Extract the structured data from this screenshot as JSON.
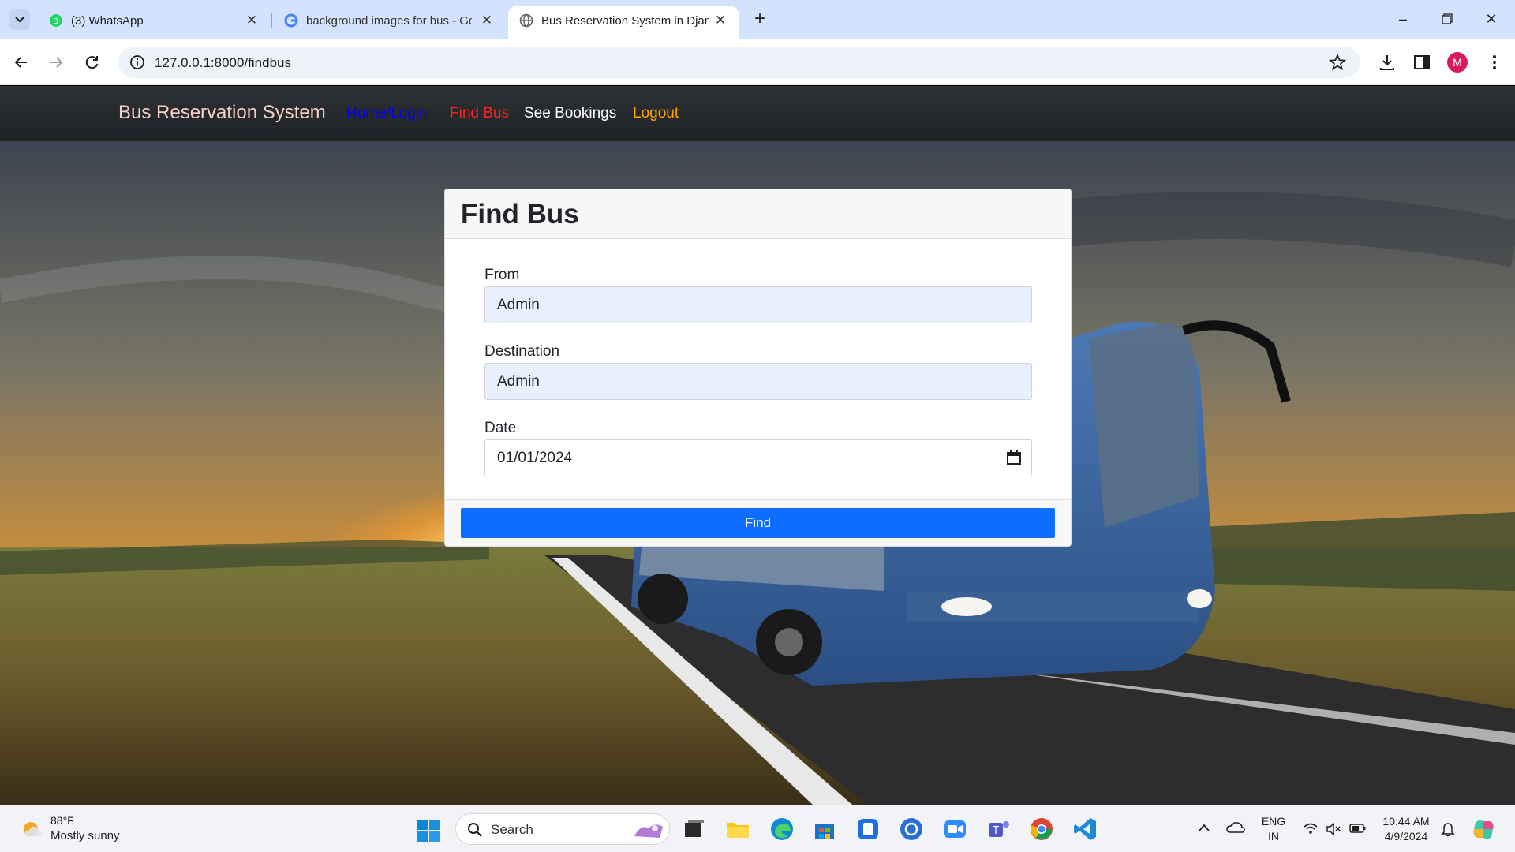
{
  "browser": {
    "tabs": [
      {
        "title": "(3) WhatsApp",
        "favicon": "whatsapp-icon"
      },
      {
        "title": "background images for bus - Goo",
        "favicon": "google-icon"
      },
      {
        "title": "Bus Reservation System in Djan",
        "favicon": "globe-icon",
        "active": true
      }
    ],
    "url": "127.0.0.1:8000/findbus",
    "profile_initial": "M"
  },
  "nav": {
    "brand": "Bus Reservation System",
    "links": [
      {
        "label": "Home/Login",
        "color": "#0000ff"
      },
      {
        "label": "Find Bus",
        "color": "#ff2020"
      },
      {
        "label": "See Bookings",
        "color": "#ffffff"
      },
      {
        "label": "Logout",
        "color": "#ffa500"
      }
    ]
  },
  "form": {
    "title": "Find Bus",
    "from_label": "From",
    "from_value": "Admin",
    "destination_label": "Destination",
    "destination_value": "Admin",
    "date_label": "Date",
    "date_value": "01/01/2024",
    "submit_label": "Find",
    "button_color": "#0d6efd"
  },
  "taskbar": {
    "weather_temp": "88°F",
    "weather_desc": "Mostly sunny",
    "search_label": "Search",
    "lang_line1": "ENG",
    "lang_line2": "IN",
    "time": "10:44 AM",
    "date": "4/9/2024"
  }
}
